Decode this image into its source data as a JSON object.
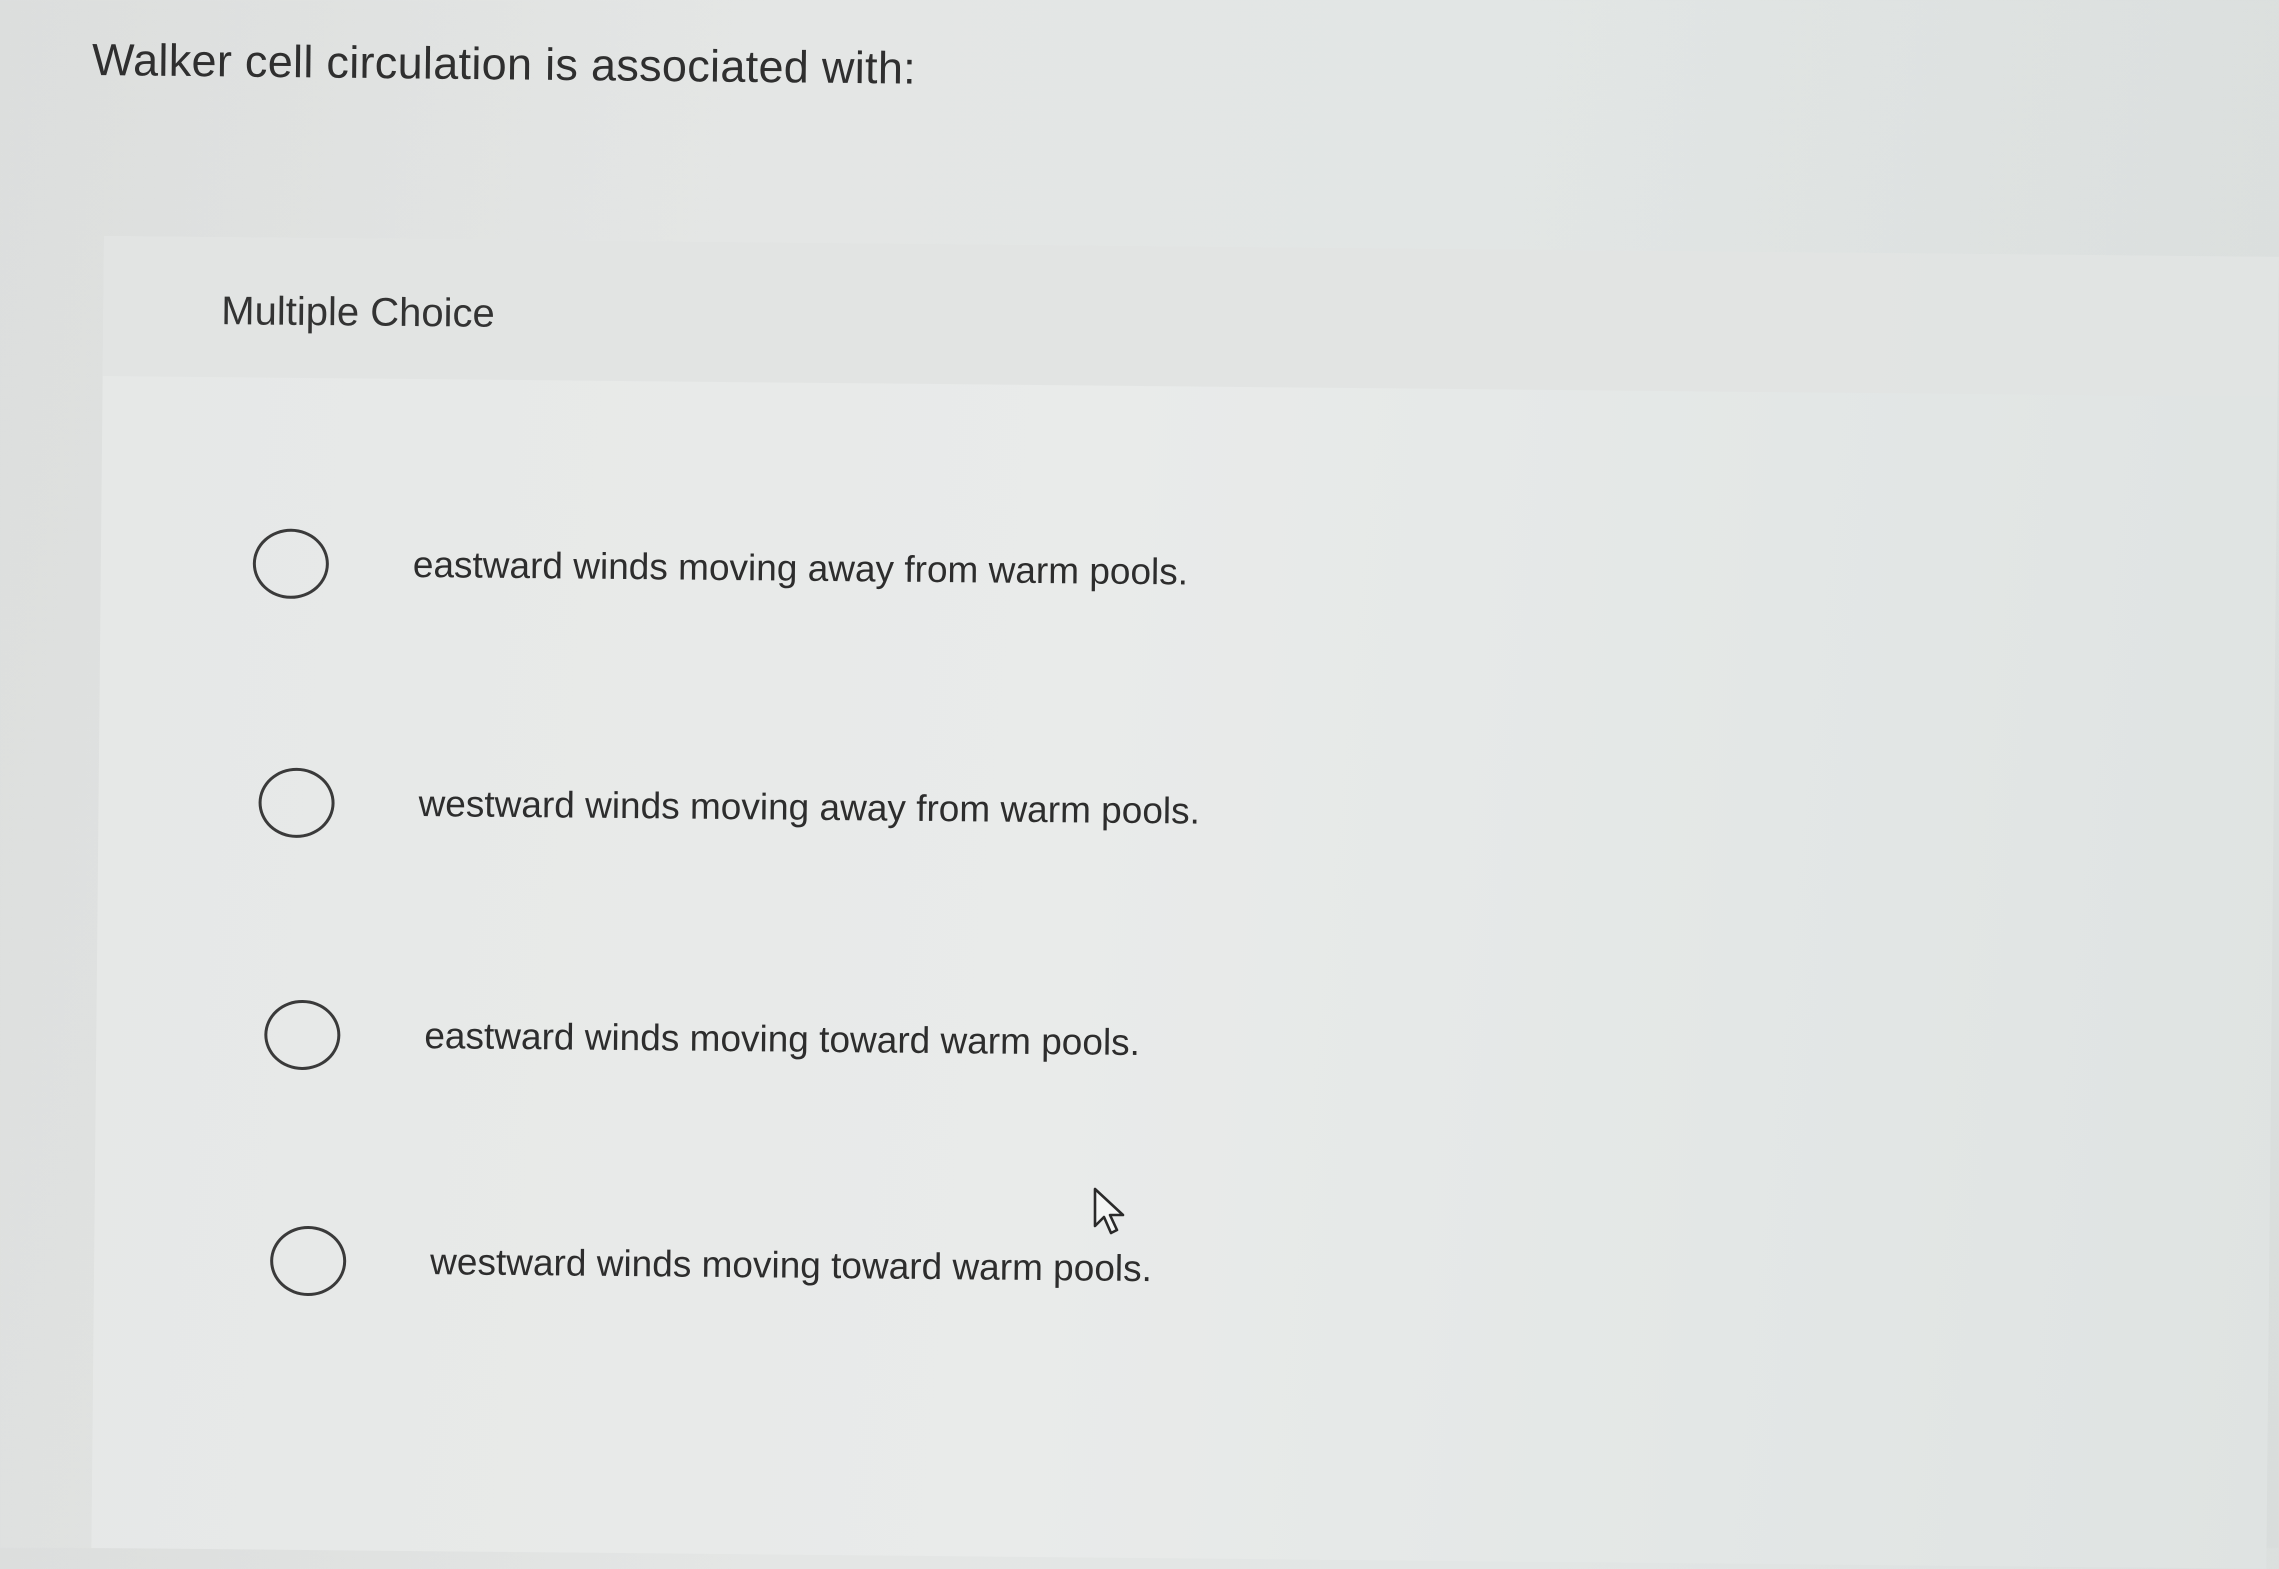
{
  "question": {
    "text": "Walker cell circulation is associated with:"
  },
  "multiple_choice": {
    "title": "Multiple Choice",
    "options": [
      {
        "label": "eastward winds moving away from warm pools.",
        "selected": false
      },
      {
        "label": "westward winds moving away from warm pools.",
        "selected": false
      },
      {
        "label": "eastward winds moving toward warm pools.",
        "selected": false
      },
      {
        "label": "westward winds moving toward warm pools.",
        "selected": false
      }
    ]
  },
  "icons": {
    "radio": "radio-button-unchecked-icon",
    "cursor": "mouse-pointer-icon"
  },
  "colors": {
    "text": "#2d2d2d",
    "background": "#e2e5e4",
    "radio_border": "#3a3a3a"
  }
}
